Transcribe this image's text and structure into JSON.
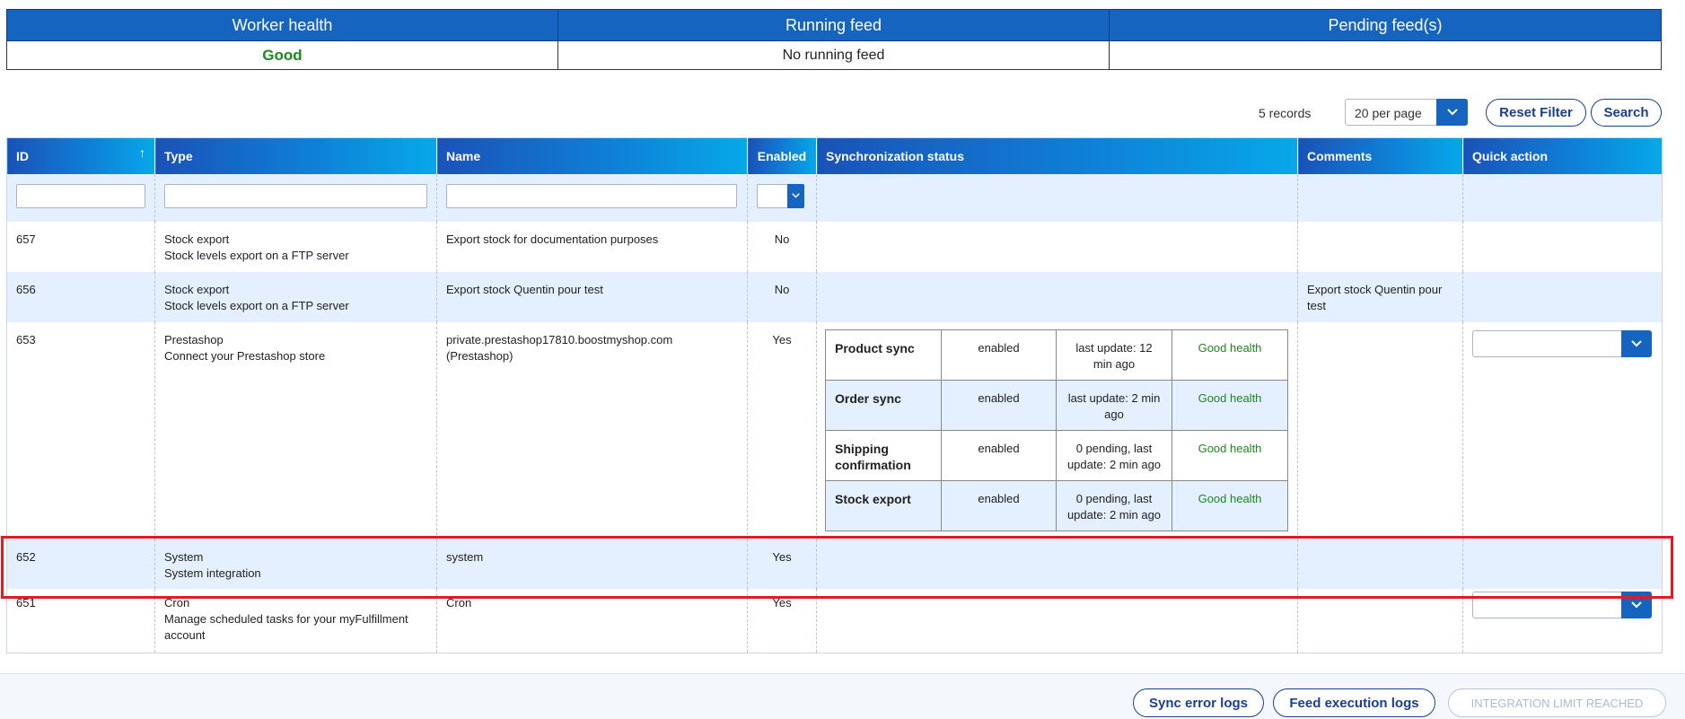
{
  "status": {
    "headers": [
      "Worker health",
      "Running feed",
      "Pending feed(s)"
    ],
    "worker_health": "Good",
    "running_feed": "No running feed",
    "pending_feeds": ""
  },
  "toolbar": {
    "records": "5 records",
    "per_page": "20 per page",
    "reset_filter": "Reset Filter",
    "search": "Search"
  },
  "grid": {
    "columns": {
      "id": "ID",
      "type": "Type",
      "name": "Name",
      "enabled": "Enabled",
      "sync_status": "Synchronization status",
      "comments": "Comments",
      "quick_action": "Quick action"
    },
    "rows": [
      {
        "id": "657",
        "type_title": "Stock export",
        "type_desc": "Stock levels export on a FTP server",
        "name": "Export stock for documentation purposes",
        "enabled": "No",
        "comments": ""
      },
      {
        "id": "656",
        "type_title": "Stock export",
        "type_desc": "Stock levels export on a FTP server",
        "name": "Export stock Quentin pour test",
        "enabled": "No",
        "comments": "Export stock Quentin pour test"
      },
      {
        "id": "653",
        "type_title": "Prestashop",
        "type_desc": "Connect your Prestashop store",
        "name": "private.prestashop17810.boostmyshop.com (Prestashop)",
        "enabled": "Yes",
        "comments": "",
        "sync": [
          {
            "name": "Product sync",
            "state": "enabled",
            "update": "last update: 12 min ago",
            "health": "Good health"
          },
          {
            "name": "Order sync",
            "state": "enabled",
            "update": "last update: 2 min ago",
            "health": "Good health"
          },
          {
            "name": "Shipping confirmation",
            "state": "enabled",
            "update": "0 pending, last update: 2 min ago",
            "health": "Good health"
          },
          {
            "name": "Stock export",
            "state": "enabled",
            "update": "0 pending, last update: 2 min ago",
            "health": "Good health"
          }
        ]
      },
      {
        "id": "652",
        "type_title": "System",
        "type_desc": "System integration",
        "name": "system",
        "enabled": "Yes",
        "comments": ""
      },
      {
        "id": "651",
        "type_title": "Cron",
        "type_desc": "Manage scheduled tasks for your myFulfillment account",
        "name": "Cron",
        "enabled": "Yes",
        "comments": ""
      }
    ]
  },
  "footer": {
    "sync_error_logs": "Sync error logs",
    "feed_execution_logs": "Feed execution logs",
    "integration_limit": "INTEGRATION LIMIT REACHED"
  },
  "icons": {
    "sort": "arrow-up-icon",
    "dropdown": "chevron-down-icon"
  },
  "colors": {
    "primary": "#1565c0",
    "good": "#1b8a1b",
    "highlight": "#e01b24",
    "row_alt": "#e4efff"
  }
}
